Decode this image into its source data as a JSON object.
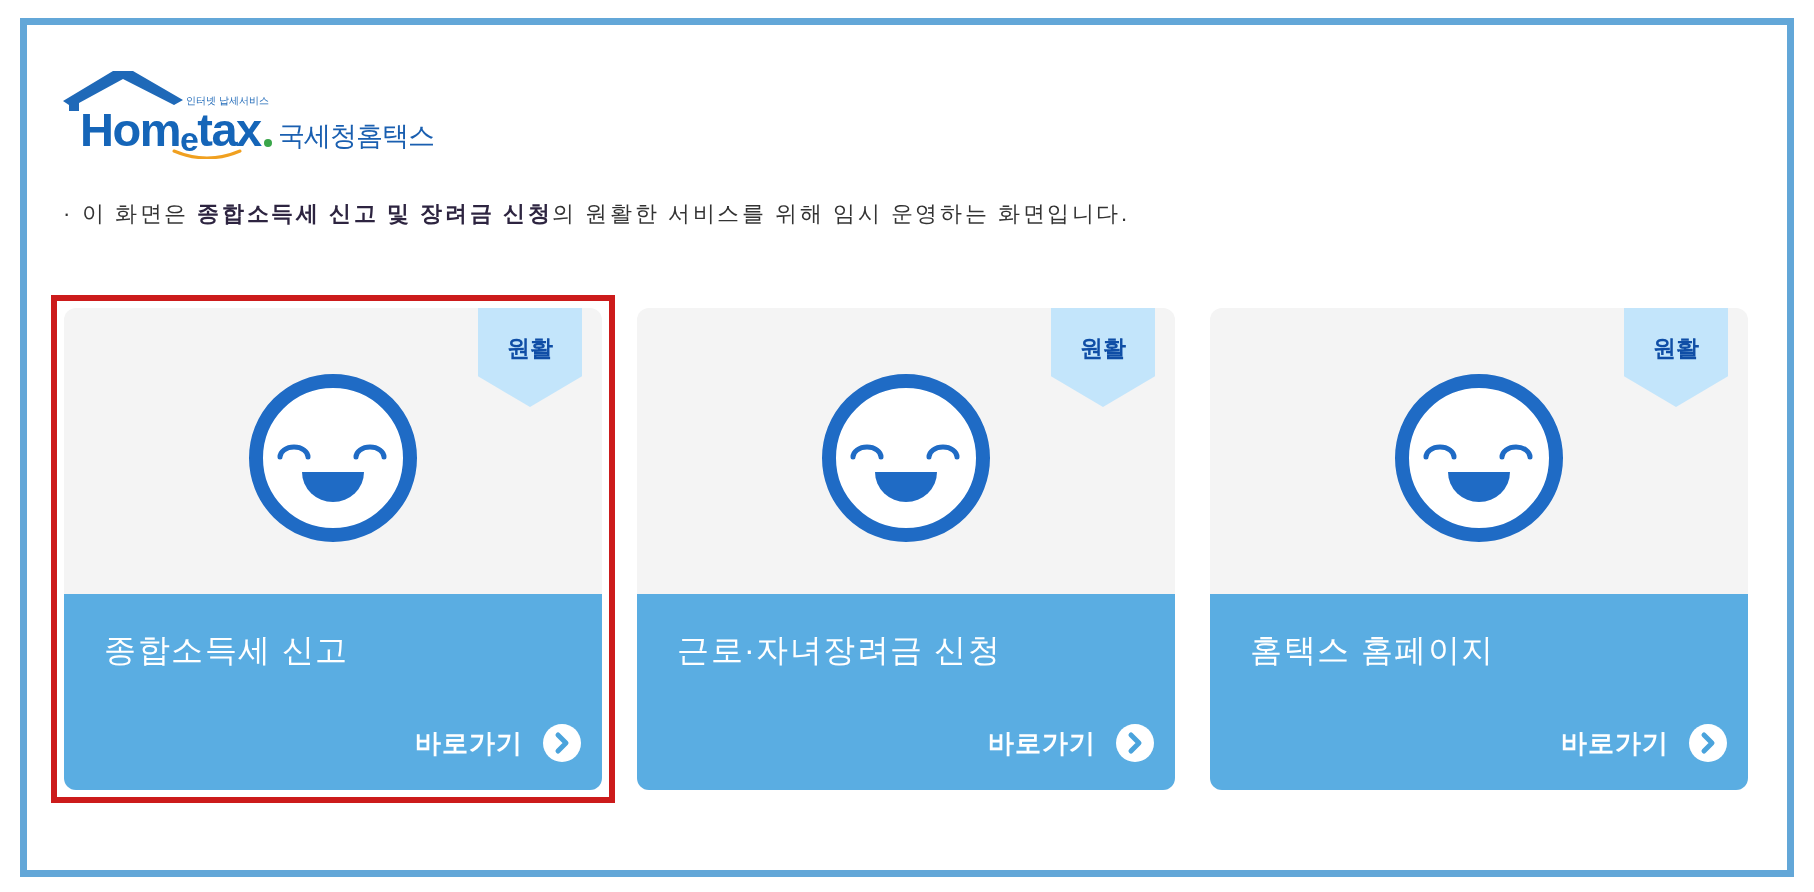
{
  "logo": {
    "tagline": "인터넷 납세서비스",
    "wordmark": "Hom$_{e}$tax",
    "org_name": "국세청홈택스"
  },
  "notice": "· 이 화면은 **종합소득세 신고 및 장려금 신청**의 원활한 서비스를 위해 임시 운영하는 화면입니다.",
  "cards": [
    {
      "title": "종합소득세 신고",
      "status": "원활",
      "link": "바로가기",
      "highlighted": true
    },
    {
      "title": "근로·자녀장려금 신청",
      "status": "원활",
      "link": "바로가기",
      "highlighted": false
    },
    {
      "title": "홈택스 홈페이지",
      "status": "원활",
      "link": "바로가기",
      "highlighted": false
    }
  ]
}
